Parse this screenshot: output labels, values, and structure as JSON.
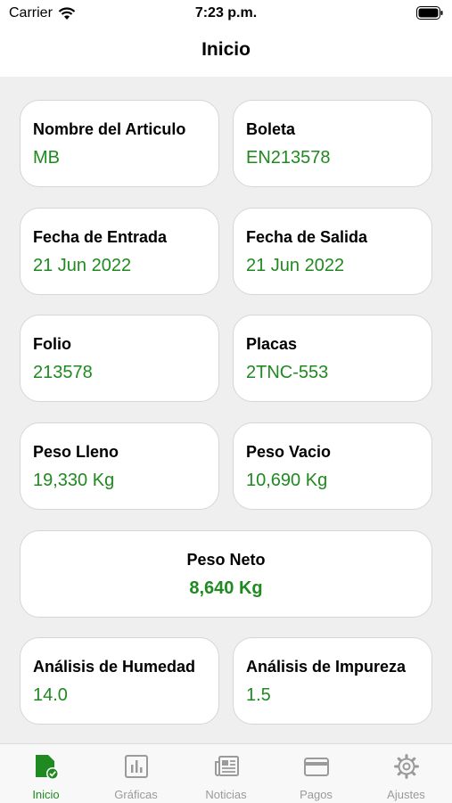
{
  "status_bar": {
    "carrier": "Carrier",
    "time": "7:23 p.m."
  },
  "nav": {
    "title": "Inicio"
  },
  "cards": {
    "articulo": {
      "label": "Nombre del Articulo",
      "value": "MB"
    },
    "boleta": {
      "label": "Boleta",
      "value": "EN213578"
    },
    "fecha_entrada": {
      "label": "Fecha de Entrada",
      "value": "21 Jun 2022"
    },
    "fecha_salida": {
      "label": "Fecha de Salida",
      "value": "21 Jun 2022"
    },
    "folio": {
      "label": "Folio",
      "value": "213578"
    },
    "placas": {
      "label": "Placas",
      "value": "2TNC-553"
    },
    "peso_lleno": {
      "label": "Peso Lleno",
      "value": "19,330 Kg"
    },
    "peso_vacio": {
      "label": "Peso Vacio",
      "value": "10,690 Kg"
    },
    "peso_neto": {
      "label": "Peso Neto",
      "value": "8,640 Kg"
    },
    "humedad": {
      "label": "Análisis de Humedad",
      "value": "14.0"
    },
    "impureza": {
      "label": "Análisis de Impureza",
      "value": "1.5"
    }
  },
  "tabs": [
    {
      "label": "Inicio",
      "icon": "document-check-icon",
      "active": true
    },
    {
      "label": "Gráficas",
      "icon": "bar-chart-icon",
      "active": false
    },
    {
      "label": "Noticias",
      "icon": "newspaper-icon",
      "active": false
    },
    {
      "label": "Pagos",
      "icon": "credit-card-icon",
      "active": false
    },
    {
      "label": "Ajustes",
      "icon": "gear-icon",
      "active": false
    }
  ],
  "colors": {
    "accent": "#1f8a1f",
    "inactive": "#9a9a9a",
    "background": "#efefef"
  }
}
